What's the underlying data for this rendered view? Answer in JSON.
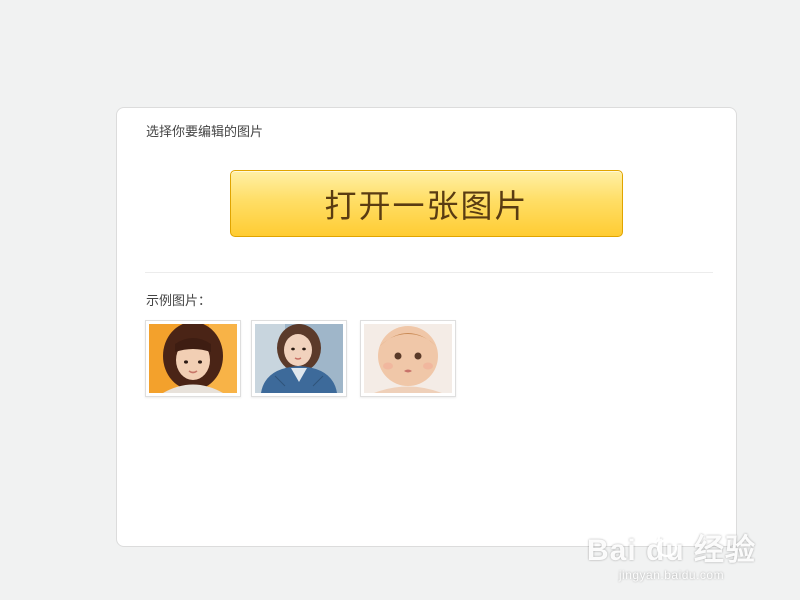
{
  "panel": {
    "heading": "选择你要编辑的图片",
    "open_button_label": "打开一张图片",
    "examples_label": "示例图片："
  },
  "examples": [
    {
      "icon": "woman-orange-background-photo"
    },
    {
      "icon": "woman-denim-jacket-photo"
    },
    {
      "icon": "baby-photo"
    }
  ],
  "watermark": {
    "logo_text": "Bai du 经验",
    "url": "jingyan.baidu.com"
  },
  "colors": {
    "background": "#f1f2f2",
    "button_top": "#fff0a6",
    "button_bottom": "#ffcc33",
    "button_text": "#5a3c12"
  }
}
